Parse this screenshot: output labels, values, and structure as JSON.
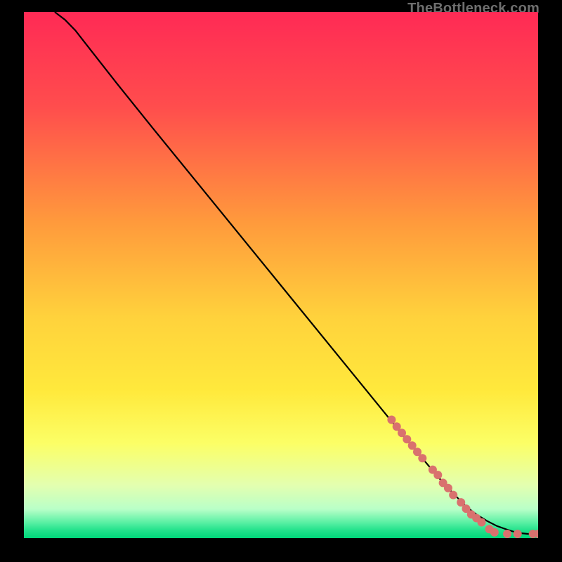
{
  "watermark": "TheBottleneck.com",
  "chart_data": {
    "type": "line",
    "title": "",
    "xlabel": "",
    "ylabel": "",
    "xlim": [
      0,
      100
    ],
    "ylim": [
      0,
      100
    ],
    "gradient_stops": [
      {
        "offset": 0.0,
        "color": "#ff2a55"
      },
      {
        "offset": 0.18,
        "color": "#ff4d4d"
      },
      {
        "offset": 0.4,
        "color": "#ff9a3c"
      },
      {
        "offset": 0.58,
        "color": "#ffd23c"
      },
      {
        "offset": 0.72,
        "color": "#ffe93c"
      },
      {
        "offset": 0.82,
        "color": "#fcff66"
      },
      {
        "offset": 0.9,
        "color": "#e3ffb0"
      },
      {
        "offset": 0.945,
        "color": "#b9ffc8"
      },
      {
        "offset": 0.97,
        "color": "#5bf0a4"
      },
      {
        "offset": 0.985,
        "color": "#23e28c"
      },
      {
        "offset": 1.0,
        "color": "#00d77a"
      }
    ],
    "series": [
      {
        "name": "curve",
        "color": "#000000",
        "x": [
          6,
          8,
          10,
          12,
          14,
          18,
          25,
          35,
          50,
          65,
          75,
          82,
          86,
          88,
          90,
          92,
          94,
          96,
          98,
          100
        ],
        "y": [
          100,
          98.5,
          96.5,
          94,
          91.5,
          86.5,
          78,
          66,
          48,
          30,
          18,
          10,
          6,
          4.5,
          3.3,
          2.3,
          1.6,
          1.0,
          0.8,
          0.8
        ]
      }
    ],
    "markers": {
      "name": "dots",
      "color": "#d9716e",
      "radius": 6,
      "points": [
        {
          "x": 71.5,
          "y": 22.5
        },
        {
          "x": 72.5,
          "y": 21.2
        },
        {
          "x": 73.5,
          "y": 20.0
        },
        {
          "x": 74.5,
          "y": 18.8
        },
        {
          "x": 75.5,
          "y": 17.6
        },
        {
          "x": 76.5,
          "y": 16.4
        },
        {
          "x": 77.5,
          "y": 15.2
        },
        {
          "x": 79.5,
          "y": 13.0
        },
        {
          "x": 80.5,
          "y": 12.0
        },
        {
          "x": 81.5,
          "y": 10.5
        },
        {
          "x": 82.5,
          "y": 9.5
        },
        {
          "x": 83.5,
          "y": 8.2
        },
        {
          "x": 85.0,
          "y": 6.8
        },
        {
          "x": 86.0,
          "y": 5.6
        },
        {
          "x": 87.0,
          "y": 4.5
        },
        {
          "x": 88.0,
          "y": 3.8
        },
        {
          "x": 89.0,
          "y": 3.0
        },
        {
          "x": 90.5,
          "y": 1.7
        },
        {
          "x": 91.5,
          "y": 1.1
        },
        {
          "x": 94.0,
          "y": 0.8
        },
        {
          "x": 96.0,
          "y": 0.8
        },
        {
          "x": 99.0,
          "y": 0.8
        },
        {
          "x": 100.0,
          "y": 0.8
        }
      ]
    }
  }
}
